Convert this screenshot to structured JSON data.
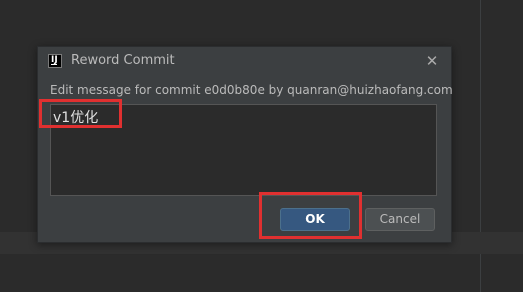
{
  "dialog": {
    "title": "Reword Commit",
    "app_icon": "IJ",
    "close_icon": "close-icon",
    "description": "Edit message for commit e0d0b80e by quanran@huizhaofang.com",
    "message": "v1优化",
    "ok_label": "OK",
    "cancel_label": "Cancel"
  },
  "colors": {
    "ide_background": "#2b2b2b",
    "dialog_background": "#3c3f41",
    "primary_button": "#365880",
    "highlight": "#e03030"
  }
}
